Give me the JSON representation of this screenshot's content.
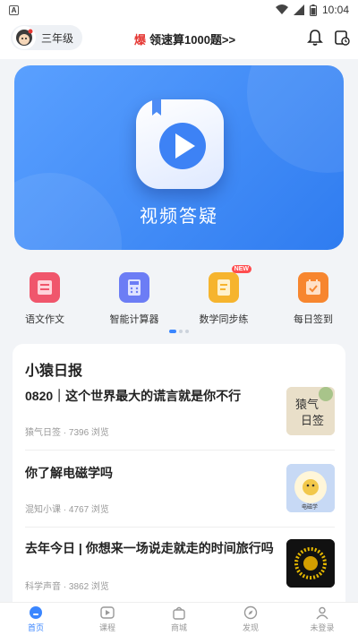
{
  "status_bar": {
    "time": "10:04"
  },
  "header": {
    "grade_label": "三年级",
    "promo_text": "领速算1000题>>"
  },
  "banner": {
    "title": "视频答疑"
  },
  "tools": [
    {
      "label": "语文作文",
      "color": "#f0566c",
      "badge": ""
    },
    {
      "label": "智能计算器",
      "color": "#6c7df5",
      "badge": ""
    },
    {
      "label": "数学同步练",
      "color": "#f6b42e",
      "badge": "NEW"
    },
    {
      "label": "每日签到",
      "color": "#f7862f",
      "badge": ""
    }
  ],
  "daily": {
    "title": "小猿日报",
    "items": [
      {
        "title": "0820｜这个世界最大的谎言就是你不行",
        "meta": "猿气日签 · 7396 浏览",
        "thumb_text": "猿气日签",
        "thumb_color": "#e9dfc9"
      },
      {
        "title": "你了解电磁学吗",
        "meta": "混知小课 · 4767 浏览",
        "thumb_text": "电磁学",
        "thumb_color": "#c7d9f5"
      },
      {
        "title": "去年今日 | 你想来一场说走就走的时间旅行吗",
        "meta": "科学声音 · 3862 浏览",
        "thumb_text": "",
        "thumb_color": "#1a1a1a"
      }
    ]
  },
  "tabbar": {
    "tabs": [
      {
        "label": "首页",
        "active": true
      },
      {
        "label": "课程",
        "active": false
      },
      {
        "label": "商城",
        "active": false
      },
      {
        "label": "发现",
        "active": false
      },
      {
        "label": "未登录",
        "active": false
      }
    ]
  },
  "colors": {
    "accent": "#3a86ff",
    "banner": "#2f7cf0"
  }
}
